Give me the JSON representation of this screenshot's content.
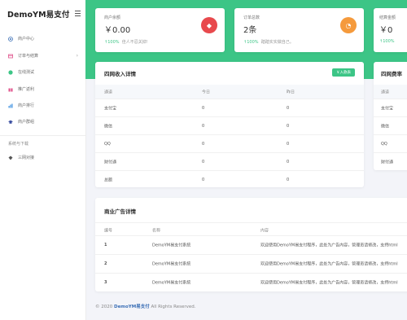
{
  "brand": "DemoYM易支付",
  "nav": [
    {
      "label": "商户中心",
      "icon": "home-icon",
      "color": "#3b6fb6"
    },
    {
      "label": "订单与结算",
      "icon": "card-icon",
      "color": "#e0508a",
      "arrow": "›"
    },
    {
      "label": "在线测试",
      "icon": "test-icon",
      "color": "#3cc586"
    },
    {
      "label": "推广返利",
      "icon": "gift-icon",
      "color": "#e0508a"
    },
    {
      "label": "商户排行",
      "icon": "chart-icon",
      "color": "#3b8fe0"
    },
    {
      "label": "商户群组",
      "icon": "grad-cap-icon",
      "color": "#3b4fa0"
    }
  ],
  "nav_section": "系统与下载",
  "nav_extra": {
    "label": "三网对接",
    "icon": "diamond-icon",
    "color": "#555"
  },
  "stats": [
    {
      "label": "商户余额",
      "value": "￥0.00",
      "arrow": "↑",
      "pct": "100%",
      "sub": "佳人不忍关掉!",
      "icon_color": "#e8494d",
      "icon": "diamond-icon",
      "glyph": "◆"
    },
    {
      "label": "订单总数",
      "value": "2条",
      "arrow": "↑",
      "pct": "100%",
      "sub": "踏踏实实做自己。",
      "icon_color": "#f59a3c",
      "icon": "pie-icon",
      "glyph": "◔"
    },
    {
      "label": "结算金额",
      "value": "￥0",
      "arrow": "↑",
      "pct": "100%",
      "sub": ""
    }
  ],
  "income": {
    "title": "四网收入详情",
    "button": "￥入款表",
    "headers": [
      "通道",
      "今日",
      "昨日"
    ],
    "rows": [
      [
        "支付宝",
        "0",
        "0"
      ],
      [
        "微信",
        "0",
        "0"
      ],
      [
        "QQ",
        "0",
        "0"
      ],
      [
        "财付通",
        "0",
        "0"
      ],
      [
        "总额",
        "0",
        "0"
      ]
    ]
  },
  "fee": {
    "title": "四网费率",
    "headers": [
      "通道"
    ],
    "rows": [
      [
        "支付宝"
      ],
      [
        "微信"
      ],
      [
        "QQ"
      ],
      [
        "财付通"
      ]
    ]
  },
  "ads": {
    "title": "商业广告详情",
    "headers": [
      "编号",
      "名称",
      "内容"
    ],
    "rows": [
      [
        "1",
        "DemoYM易支付系统",
        "欢迎使用DemoYM易支付程序，此处为广告内容，管理员请修改，支持html"
      ],
      [
        "2",
        "DemoYM易支付系统",
        "欢迎使用DemoYM易支付程序，此处为广告内容，管理员请修改，支持html"
      ],
      [
        "3",
        "DemoYM易支付系统",
        "欢迎使用DemoYM易支付程序，此处为广告内容，管理员请修改，支持html"
      ]
    ]
  },
  "footer": {
    "prefix": "© 2020",
    "brand": "DemoYM易支付",
    "suffix": "All Rights Reserved."
  }
}
